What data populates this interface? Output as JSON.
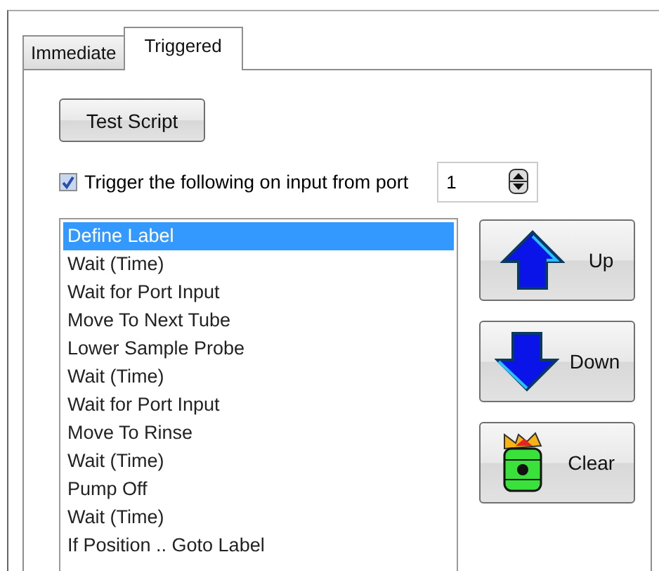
{
  "tabs": [
    {
      "label": "Immediate",
      "selected": false
    },
    {
      "label": "Triggered",
      "selected": true
    }
  ],
  "test_button": "Test Script",
  "trigger": {
    "checked": true,
    "label": "Trigger the following on input from port",
    "port": "1"
  },
  "steps": [
    {
      "label": "Define Label",
      "selected": true
    },
    {
      "label": "Wait (Time)",
      "selected": false
    },
    {
      "label": "Wait for Port Input",
      "selected": false
    },
    {
      "label": "Move To Next Tube",
      "selected": false
    },
    {
      "label": "Lower Sample Probe",
      "selected": false
    },
    {
      "label": "Wait (Time)",
      "selected": false
    },
    {
      "label": "Wait for Port Input",
      "selected": false
    },
    {
      "label": "Move To Rinse",
      "selected": false
    },
    {
      "label": "Wait (Time)",
      "selected": false
    },
    {
      "label": "Pump Off",
      "selected": false
    },
    {
      "label": "Wait (Time)",
      "selected": false
    },
    {
      "label": "If Position .. Goto Label",
      "selected": false
    }
  ],
  "actions": [
    {
      "kind": "up",
      "label": "Up"
    },
    {
      "kind": "down",
      "label": "Down"
    },
    {
      "kind": "clear",
      "label": "Clear"
    }
  ]
}
